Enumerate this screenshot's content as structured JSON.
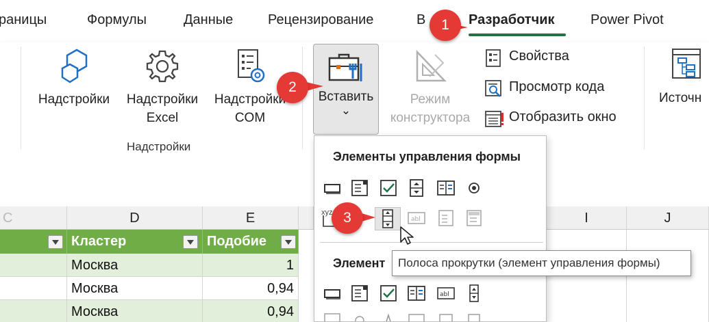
{
  "tabs": [
    {
      "label": "раницы"
    },
    {
      "label": "Формулы"
    },
    {
      "label": "Данные"
    },
    {
      "label": "Рецензирование"
    },
    {
      "label": "В"
    },
    {
      "label": "Разработчик"
    },
    {
      "label": "Power Pivot"
    }
  ],
  "ribbon": {
    "addins_label": "Надстройки",
    "excel_addins": [
      "Надстройки",
      "Excel"
    ],
    "com_addins": [
      "Надстройки",
      "COM"
    ],
    "group_label": "Надстройки",
    "insert_label": "Вставить",
    "insert_chevron": "⌄",
    "design_mode": [
      "Режим",
      "конструктора"
    ],
    "properties": "Свойства",
    "view_code": "Просмотр кода",
    "show_window": "Отобразить окно",
    "source_partial": "Источн"
  },
  "gallery": {
    "form_controls_title": "Элементы управления формы",
    "activex_title_partial": "Элемент",
    "xyz_partial": "xyz"
  },
  "tooltip": "Полоса прокрутки (элемент управления формы)",
  "sheet": {
    "columns": [
      "C",
      "D",
      "E",
      "I",
      "J"
    ],
    "headers": {
      "cluster": "Кластер",
      "similarity": "Подобие"
    },
    "rows": [
      {
        "cluster": "Москва",
        "similarity": "1"
      },
      {
        "cluster": "Москва",
        "similarity": "0,94"
      },
      {
        "cluster": "Москва",
        "similarity": "0,94"
      }
    ]
  },
  "badges": {
    "one": "1",
    "two": "2",
    "three": "3"
  },
  "colors": {
    "accent_green": "#217346",
    "table_header": "#70ad47",
    "badge_red": "#e53935",
    "band_light": "#e2efda"
  }
}
